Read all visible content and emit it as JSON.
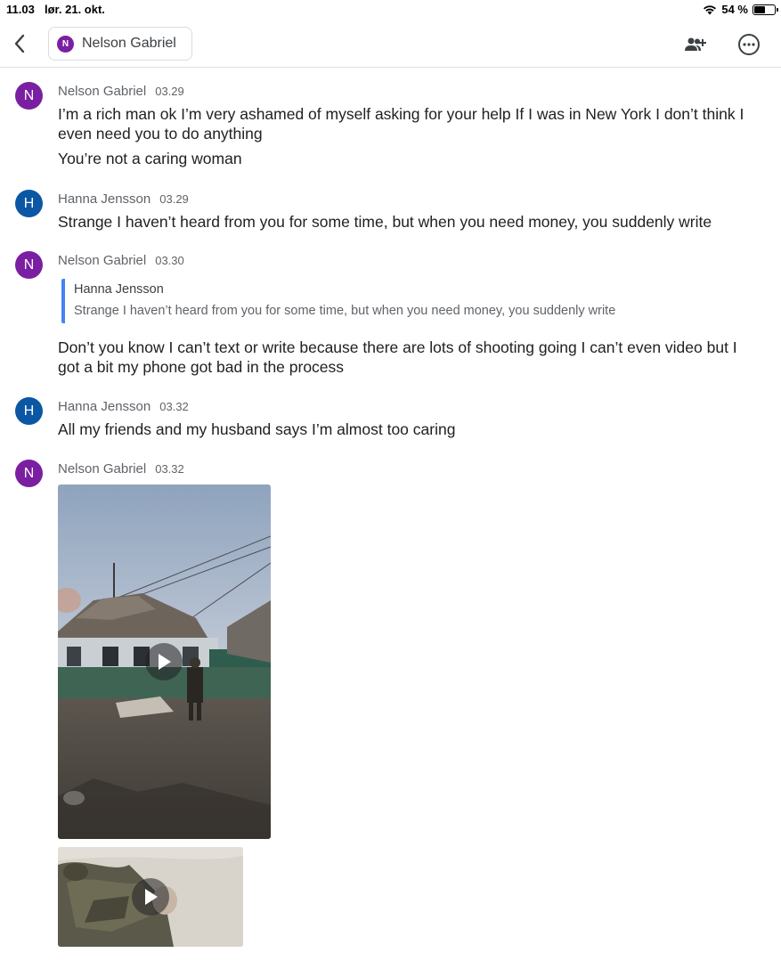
{
  "status_bar": {
    "time": "11.03",
    "date": "lør. 21. okt.",
    "battery": "54 %",
    "battery_level": 0.54
  },
  "header": {
    "avatar_initial": "N",
    "title": "Nelson Gabriel"
  },
  "messages": [
    {
      "sender": "Nelson Gabriel",
      "initial": "N",
      "time": "03.29",
      "lines": [
        "I’m a rich man ok I’m very ashamed of myself asking for your help If I was in New York I don’t think I even need you to do anything",
        "You’re not a caring woman"
      ]
    },
    {
      "sender": "Hanna Jensson",
      "initial": "H",
      "time": "03.29",
      "lines": [
        "Strange I haven’t heard from you for some time, but when you need money, you suddenly write"
      ]
    },
    {
      "sender": "Nelson Gabriel",
      "initial": "N",
      "time": "03.30",
      "quote": {
        "author": "Hanna Jensson",
        "text": "Strange I haven’t heard from you for some time, but when you need money, you suddenly write"
      },
      "lines": [
        "Don’t you know I can’t text or write because there are lots of shooting going I can’t even video but I got a bit my phone got bad in the process"
      ]
    },
    {
      "sender": "Hanna Jensson",
      "initial": "H",
      "time": "03.32",
      "lines": [
        "All my friends and my husband says I’m almost too caring"
      ]
    },
    {
      "sender": "Nelson Gabriel",
      "initial": "N",
      "time": "03.32",
      "attachments": [
        "video",
        "video"
      ]
    }
  ],
  "colors": {
    "nelson_avatar": "#7b1fa2",
    "hanna_avatar": "#0b57a4",
    "quote_bar": "#4285f4"
  },
  "icons": [
    "chevron-left-icon",
    "add-people-icon",
    "more-options-icon",
    "play-icon",
    "wifi-icon",
    "battery-icon"
  ]
}
